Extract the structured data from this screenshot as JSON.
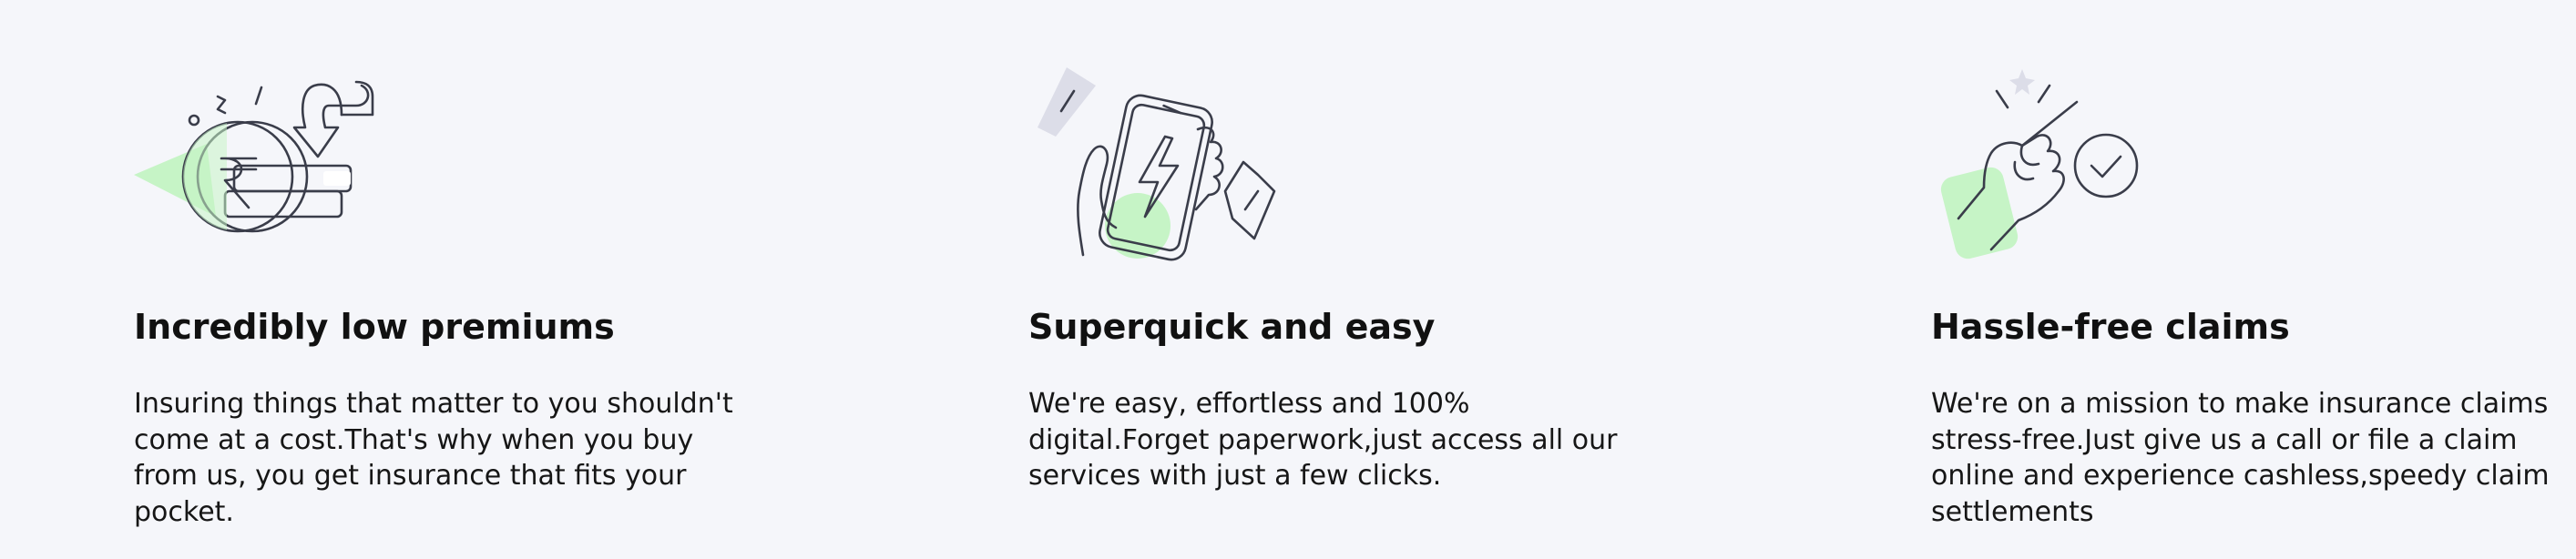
{
  "colors": {
    "background": "#f5f6fa",
    "accent_green": "#c6f4c6",
    "accent_grey": "#dcdde8",
    "line": "#3a3d4a",
    "text": "#111111"
  },
  "features": [
    {
      "icon": "rupee-coin-icon",
      "title": "Incredibly low premiums",
      "description": "Insuring things that matter to you shouldn't come at a cost.That's why when you buy from us, you get insurance that fits your pocket."
    },
    {
      "icon": "phone-lightning-icon",
      "title": "Superquick and easy",
      "description": "We're easy, effortless and 100% digital.Forget paperwork,just access all our services with just a few clicks."
    },
    {
      "icon": "snap-check-icon",
      "title": "Hassle-free claims",
      "description": "We're on a mission to make insurance claims stress-free.Just give us a call or file a claim online and experience cashless,speedy claim settlements"
    }
  ]
}
